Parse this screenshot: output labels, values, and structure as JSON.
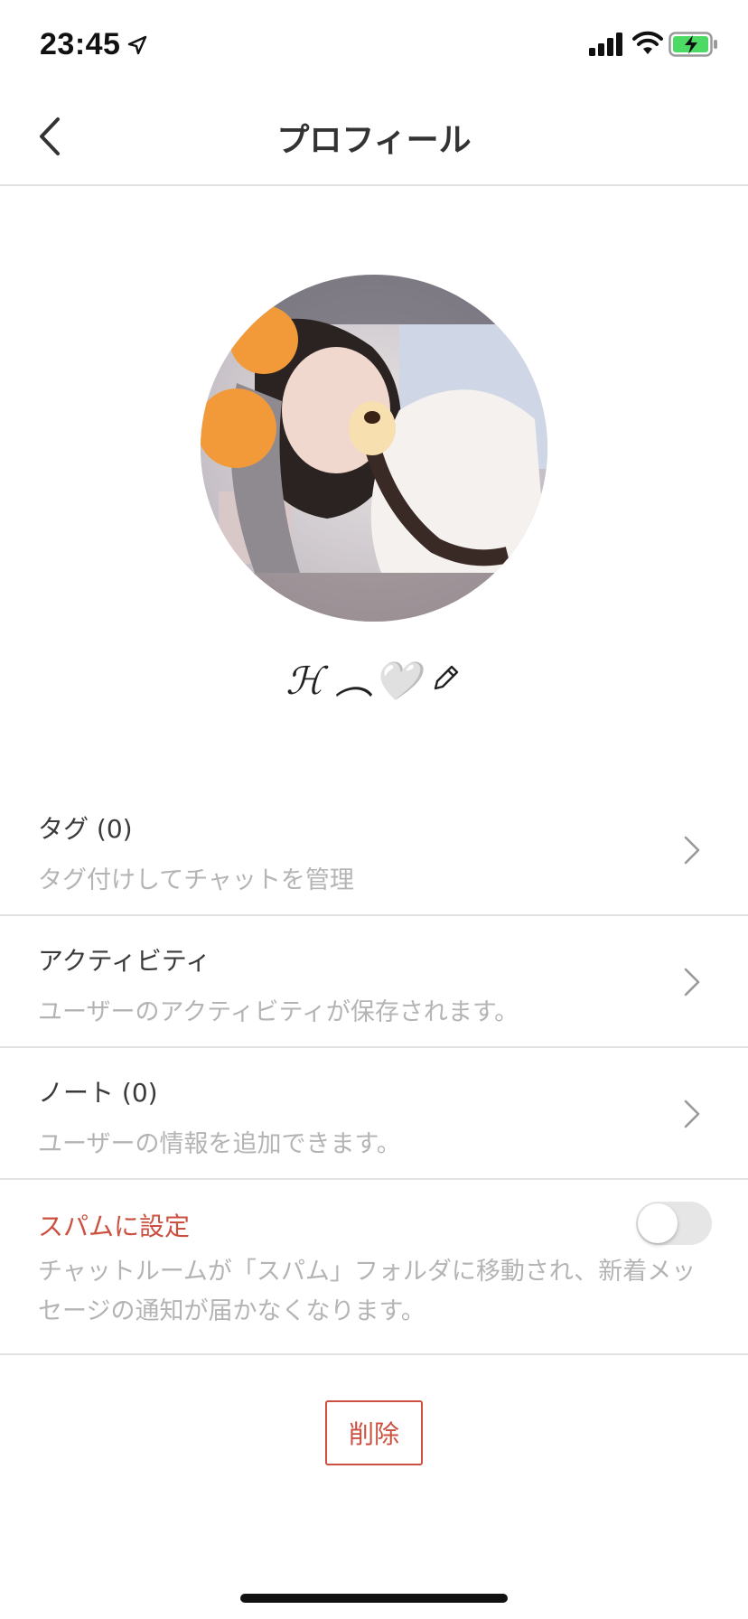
{
  "status_bar": {
    "time": "23:45",
    "icons": [
      "location-arrow-icon",
      "cellular-signal-icon",
      "wifi-icon",
      "battery-charging-icon"
    ]
  },
  "nav": {
    "title": "プロフィール",
    "back_icon": "chevron-left-icon"
  },
  "profile": {
    "display_name": "ℋ ︵🤍",
    "edit_icon": "pencil-icon"
  },
  "rows": [
    {
      "title": "タグ (0)",
      "subtitle": "タグ付けしてチャットを管理"
    },
    {
      "title": "アクティビティ",
      "subtitle": "ユーザーのアクティビティが保存されます。"
    },
    {
      "title": "ノート (0)",
      "subtitle": "ユーザーの情報を追加できます。"
    }
  ],
  "spam": {
    "title": "スパムに設定",
    "description": "チャットルームが「スパム」フォルダに移動され、新着メッセージの通知が届かなくなります。",
    "enabled": false
  },
  "delete_label": "削除",
  "colors": {
    "accent_red": "#cc5040",
    "divider": "#e2e2e2",
    "subtext": "#b4b4b4"
  }
}
